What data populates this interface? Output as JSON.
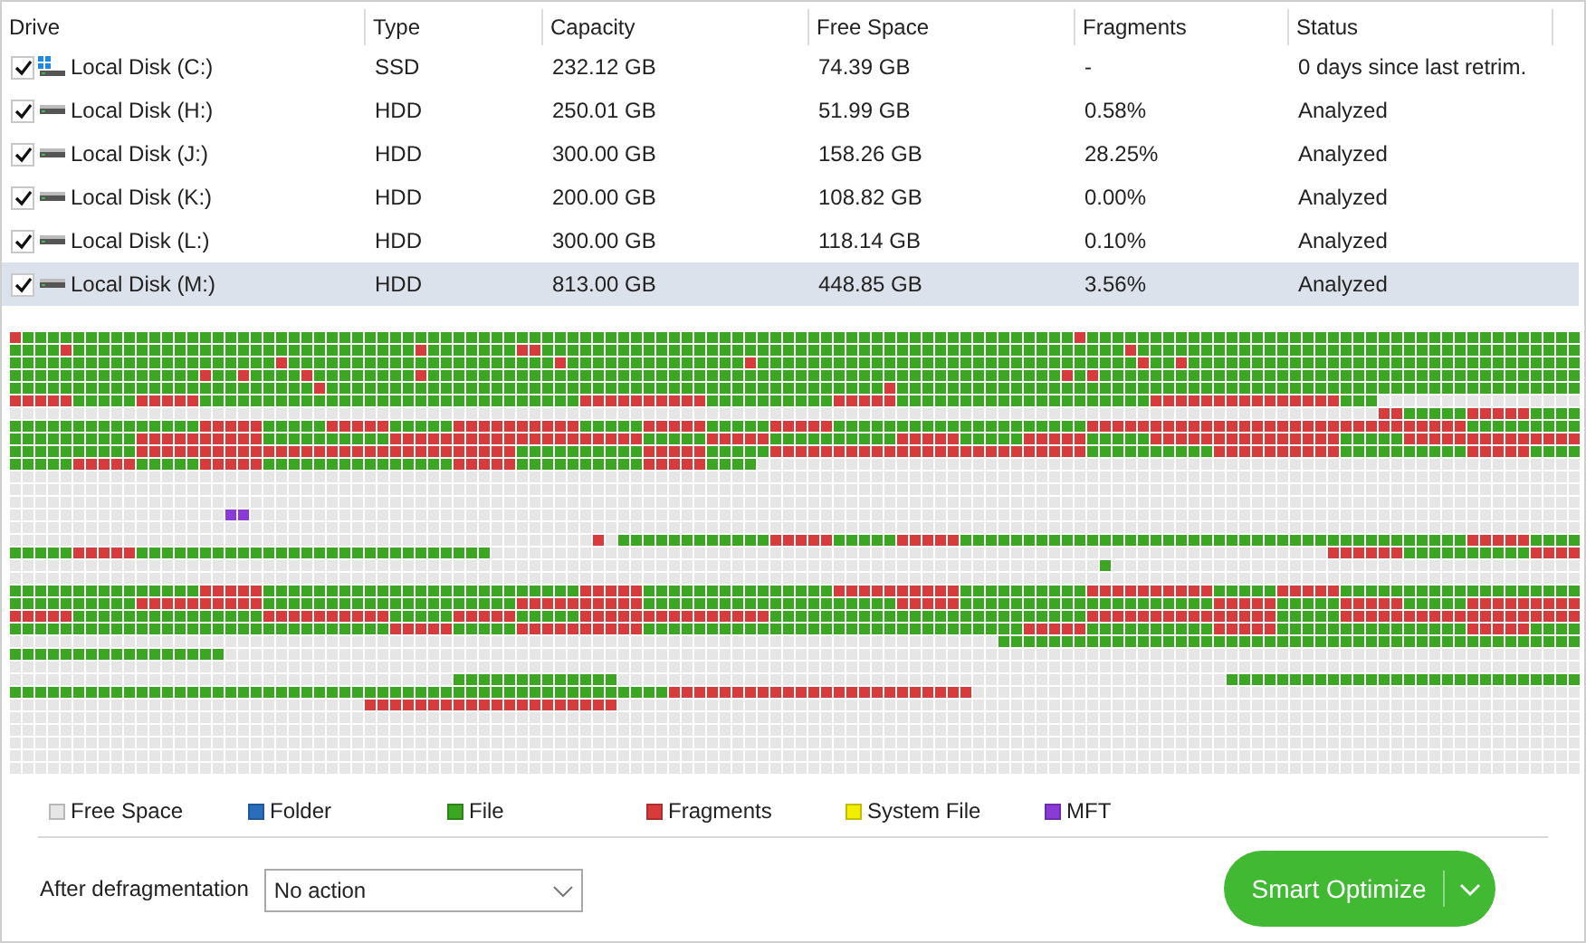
{
  "table": {
    "columns": [
      "Drive",
      "Type",
      "Capacity",
      "Free Space",
      "Fragments",
      "Status"
    ],
    "rows": [
      {
        "drive": "Local Disk (C:)",
        "kind": "system",
        "type": "SSD",
        "capacity": "232.12 GB",
        "free_space": "74.39 GB",
        "fragments": "-",
        "status": "0 days since last retrim.",
        "checked": true,
        "selected": false
      },
      {
        "drive": "Local Disk (H:)",
        "kind": "disk",
        "type": "HDD",
        "capacity": "250.01 GB",
        "free_space": "51.99 GB",
        "fragments": "0.58%",
        "status": "Analyzed",
        "checked": true,
        "selected": false
      },
      {
        "drive": "Local Disk (J:)",
        "kind": "disk",
        "type": "HDD",
        "capacity": "300.00 GB",
        "free_space": "158.26 GB",
        "fragments": "28.25%",
        "status": "Analyzed",
        "checked": true,
        "selected": false
      },
      {
        "drive": "Local Disk (K:)",
        "kind": "disk",
        "type": "HDD",
        "capacity": "200.00 GB",
        "free_space": "108.82 GB",
        "fragments": "0.00%",
        "status": "Analyzed",
        "checked": true,
        "selected": false
      },
      {
        "drive": "Local Disk (L:)",
        "kind": "disk",
        "type": "HDD",
        "capacity": "300.00 GB",
        "free_space": "118.14 GB",
        "fragments": "0.10%",
        "status": "Analyzed",
        "checked": true,
        "selected": false
      },
      {
        "drive": "Local Disk (M:)",
        "kind": "disk",
        "type": "HDD",
        "capacity": "813.00 GB",
        "free_space": "448.85 GB",
        "fragments": "3.56%",
        "status": "Analyzed",
        "checked": true,
        "selected": true
      }
    ]
  },
  "legend": [
    {
      "label": "Free Space",
      "color": "#e6e6e6"
    },
    {
      "label": "Folder",
      "color": "#2a6ebb"
    },
    {
      "label": "File",
      "color": "#3aa622"
    },
    {
      "label": "Fragments",
      "color": "#d83b3b"
    },
    {
      "label": "System File",
      "color": "#f2ee00"
    },
    {
      "label": "MFT",
      "color": "#8a3ad6"
    }
  ],
  "after_defrag": {
    "label": "After defragmentation",
    "value": "No action"
  },
  "button": {
    "label": "Smart Optimize"
  }
}
